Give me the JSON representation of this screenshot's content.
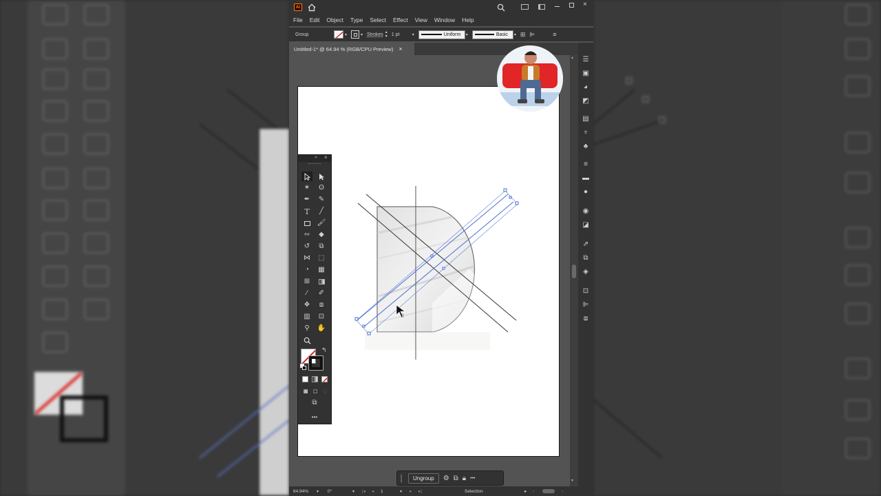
{
  "app": {
    "logo_text": "Ai",
    "menus": [
      "File",
      "Edit",
      "Object",
      "Type",
      "Select",
      "Effect",
      "View",
      "Window",
      "Help"
    ]
  },
  "control_bar": {
    "selection_label": "Group",
    "stroke_label": "Strokes",
    "stroke_value": "1 pt",
    "profile_label": "Uniform",
    "brush_label": "Basic"
  },
  "document_tab": {
    "title": "Untitled-1* @ 64.94 % (RGB/CPU Preview)",
    "close": "×"
  },
  "context_bar": {
    "ungroup_label": "Ungroup",
    "more": "•••"
  },
  "status_bar": {
    "zoom": "64.94%",
    "rotation": "0°",
    "artboard_number": "1",
    "tool_name": "Selection"
  },
  "colors": {
    "app_bg": "#535353",
    "panel": "#323232",
    "selection_blue": "#4a6fd1",
    "fill_red": "#e02020"
  }
}
